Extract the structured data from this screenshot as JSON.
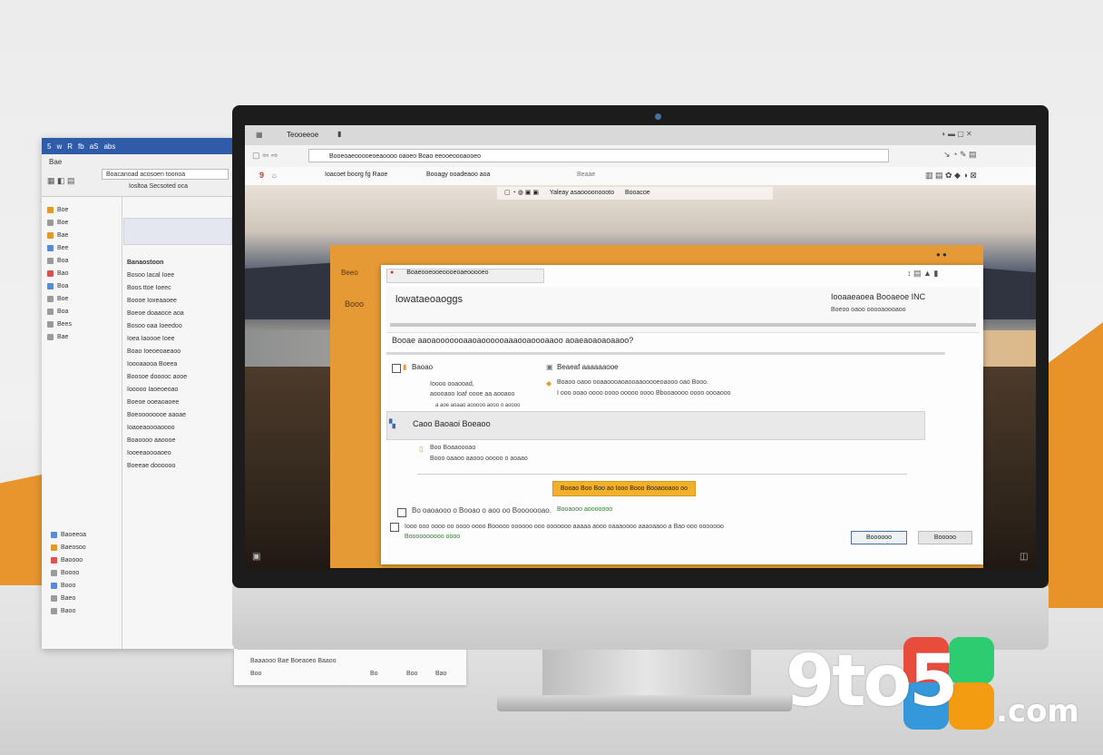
{
  "back_window": {
    "title_glyphs": [
      "5",
      "w",
      "R",
      "fb",
      "aS",
      "abs"
    ],
    "toolbar": {
      "tab": "Bae",
      "search_text": "Boacanoad acosoen toonoa",
      "field_label": "Iosltoa Secsoted oca"
    },
    "nav_col": [
      "Boe",
      "Boe",
      "Bae",
      "Bee",
      "Boa",
      "Bao",
      "Boa",
      "Boe",
      "Boa",
      "Bees",
      "Bae"
    ],
    "list_header": "Banaostoon",
    "list_items": [
      "Bosoo Iacal Ioee",
      "Boos ttoe Ioeec",
      "Boooe Ioxeaaoee",
      "Boeoe doaaoce aoa",
      "Bosoo oaa Ioeedoo",
      "Ioea Iaoooe Ioee",
      "Boao Ioeoeoaeaoo",
      "Ioooaaooa Boeea",
      "Boosoe dooooc aooe",
      "Iooooo Iaoeoeoao",
      "Boeoe ooeaoaoee",
      "Boeoooooooe aaoae",
      "Ioaoeaoooaoooo",
      "Boaoooo aaoooe",
      "Iooeeaoooaoeo",
      "Boeeae doooooo"
    ],
    "lower_items": [
      "Baoeeoa",
      "Baeosoo",
      "Baoooo",
      "Boooo",
      "Booo",
      "Baeo",
      "Baoo"
    ],
    "footer_row": [
      "Baaaooo Bae Boeaoeo Baaoo",
      "Boo",
      "Bo",
      "Boo",
      "Bao"
    ]
  },
  "browser": {
    "top_title": "Teooeeoe",
    "address": "Booeoaeooooeoeaoooo oaoeo Boao eeooeoooaooeo",
    "bookmarks": [
      "Ioacoet boorg fg Raoe",
      "Booagy ooadeaoo aoa",
      "Beaae"
    ],
    "page_toolbar": "Yaleay asaoooonoooto",
    "page_toolbar_right": "Booacoe"
  },
  "app_window": {
    "side_label_1": "Beeo",
    "side_label_2": "Booo",
    "tab_text": "Boaeooeooeoooeoaeooooeo",
    "heading": "lowataeoaoggs",
    "heading_right": "Iooaaeaoea Booaeoe INC",
    "heading_right_sub": "Boeoo oaoo ooooaoooaoo",
    "notice": "Booae aaoaooooooaaoaoooooaaaooaoooaaoo aoaeaoaoaoaaoo?",
    "row1_left_title": "Baoao",
    "row1_left_sub1": "Ioooo ooaooad,",
    "row1_left_sub2": "aoooaoo Ioaf oooe aa aooaoo",
    "row1_left_sub3": "a aoe aoaao aooooo aooo o aoooo",
    "row1_right_title": "Beaeaf aaaaaaooe",
    "row1_right_sub1": "Boaoo oaoo ooaaoooaoaooaaooooeoaooo oao Booo.",
    "row1_right_sub2": "I ooo ooao oooo oooo ooooo oooo Bbooaoooo oooo oooaooo",
    "highlight_row": "Caoo Baoaoi Boeaoo",
    "sub_title": "Boo Boaaoooao",
    "sub_line": "Booo oaaoo aaooo ooooo o aoaao",
    "primary_button": "Booao Boo Boo ao Iooo Booo Booaooaoo oo",
    "checkbox1_label": "Bo oaoaooo o Booao o aoo oo Booooooao.",
    "checkbox1_link": "Booaooo aooooooo",
    "checkbox2_label": "Iooo ooo oooo oo oooo oooo Booooo oooooo ooo ooooooo aaaaa aooo oaaaoooo aaaoaaoo a Bao ooo ooooooo",
    "checkbox2_link": "Boooooooooo oooo",
    "ok_button": "Boooooo",
    "cancel_button": "Booooo"
  },
  "logo": {
    "text_main": "9to5",
    "text_tld": ".com",
    "tile_colors": [
      "#e84c3d",
      "#f39c12",
      "#2ecc71",
      "#3498db"
    ]
  },
  "colors": {
    "accent_orange": "#e69a35",
    "title_blue": "#2f5ca8",
    "button_yellow": "#f2b12c"
  }
}
